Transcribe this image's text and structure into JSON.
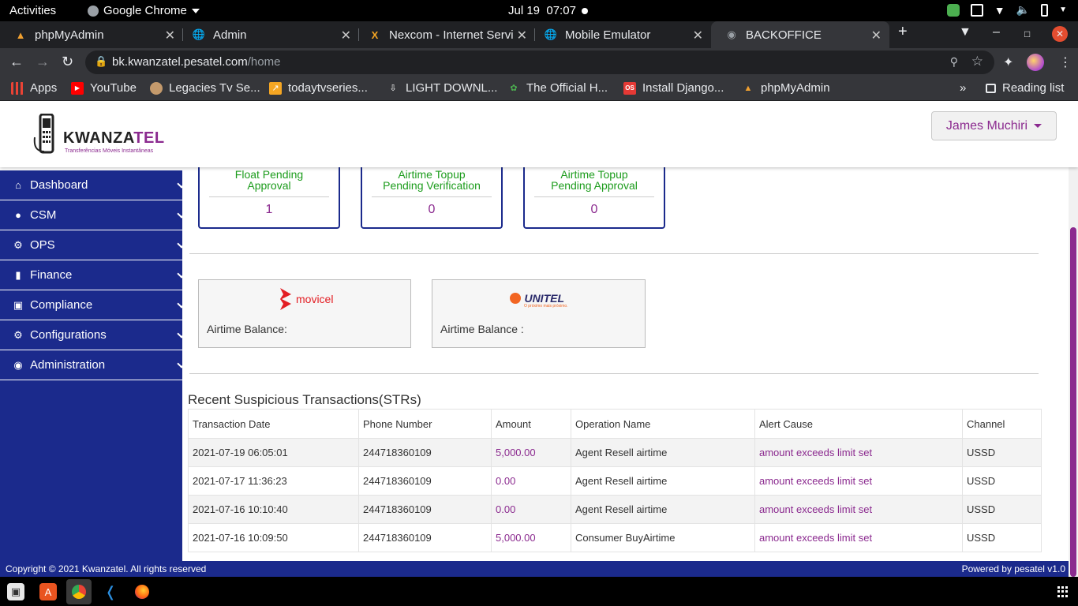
{
  "system": {
    "activities": "Activities",
    "app_name": "Google Chrome",
    "date": "Jul 19",
    "time": "07:07"
  },
  "tabs": [
    {
      "title": "phpMyAdmin",
      "icon": "phpmyadmin-icon",
      "active": false
    },
    {
      "title": "Admin",
      "icon": "globe-icon",
      "active": false
    },
    {
      "title": "Nexcom - Internet Servi",
      "icon": "nexcom-icon",
      "active": false
    },
    {
      "title": "Mobile Emulator",
      "icon": "globe-icon",
      "active": false
    },
    {
      "title": "BACKOFFICE",
      "icon": "loading-icon",
      "active": true
    }
  ],
  "address_bar": {
    "host": "bk.kwanzatel.pesatel.com",
    "path": "/home"
  },
  "bookmarks": [
    {
      "label": "Apps",
      "icon": "apps-grid-icon",
      "color": "#ea4335"
    },
    {
      "label": "YouTube",
      "icon": "youtube-icon",
      "color": "#ff0000"
    },
    {
      "label": "Legacies Tv Se...",
      "icon": "person-icon",
      "color": "#c49a6c"
    },
    {
      "label": "todaytvseries...",
      "icon": "trend-icon",
      "color": "#f5a623"
    },
    {
      "label": "LIGHT DOWNL...",
      "icon": "download-icon",
      "color": "#ffffff"
    },
    {
      "label": "The Official H...",
      "icon": "leaf-icon",
      "color": "#4caf50"
    },
    {
      "label": "Install Django...",
      "icon": "os-icon",
      "color": "#e53935"
    },
    {
      "label": "phpMyAdmin",
      "icon": "phpmyadmin-icon",
      "color": "#f0a030"
    }
  ],
  "reading_list": "Reading list",
  "header": {
    "brand_main": "KWANZA",
    "brand_accent": "TEL",
    "tagline": "Transferências Móveis Instantâneas",
    "user_name": "James Muchiri"
  },
  "sidebar": {
    "items": [
      {
        "label": "Dashboard",
        "icon": "home-icon"
      },
      {
        "label": "CSM",
        "icon": "user-icon"
      },
      {
        "label": "OPS",
        "icon": "gear-icon"
      },
      {
        "label": "Finance",
        "icon": "book-icon"
      },
      {
        "label": "Compliance",
        "icon": "briefcase-icon"
      },
      {
        "label": "Configurations",
        "icon": "cogs-icon"
      },
      {
        "label": "Administration",
        "icon": "eye-icon"
      }
    ]
  },
  "stat_cards": [
    {
      "line1": "Float Pending",
      "line2": "Approval",
      "value": "1"
    },
    {
      "line1": "Airtime Topup",
      "line2": "Pending Verification",
      "value": "0"
    },
    {
      "line1": "Airtime Topup",
      "line2": "Pending Approval",
      "value": "0"
    }
  ],
  "balances": [
    {
      "operator": "movicel",
      "label": "Airtime Balance:"
    },
    {
      "operator": "UNITEL",
      "slogan": "O próximo mais próximo.",
      "label": "Airtime Balance :"
    }
  ],
  "str_section": {
    "title": "Recent Suspicious Transactions(STRs)",
    "columns": [
      "Transaction Date",
      "Phone Number",
      "Amount",
      "Operation Name",
      "Alert Cause",
      "Channel"
    ],
    "rows": [
      {
        "date": "2021-07-19 06:05:01",
        "phone": "244718360109",
        "amount": "5,000.00",
        "operation": "Agent Resell airtime",
        "cause": "amount exceeds limit set",
        "channel": "USSD"
      },
      {
        "date": "2021-07-17 11:36:23",
        "phone": "244718360109",
        "amount": "0.00",
        "operation": "Agent Resell airtime",
        "cause": "amount exceeds limit set",
        "channel": "USSD"
      },
      {
        "date": "2021-07-16 10:10:40",
        "phone": "244718360109",
        "amount": "0.00",
        "operation": "Agent Resell airtime",
        "cause": "amount exceeds limit set",
        "channel": "USSD"
      },
      {
        "date": "2021-07-16 10:09:50",
        "phone": "244718360109",
        "amount": "5,000.00",
        "operation": "Consumer BuyAirtime",
        "cause": "amount exceeds limit set",
        "channel": "USSD"
      }
    ]
  },
  "footer": {
    "copyright": "Copyright © 2021 Kwanzatel. All rights reserved",
    "powered": "Powered by pesatel v1.0"
  },
  "colors": {
    "sidebar": "#1b2a8c",
    "accent": "#8b2a8f",
    "stat_label": "#1c9c1c"
  },
  "taskbar": [
    {
      "name": "files-icon"
    },
    {
      "name": "software-icon"
    },
    {
      "name": "chrome-icon",
      "active": true
    },
    {
      "name": "vscode-icon"
    },
    {
      "name": "firefox-icon"
    }
  ]
}
